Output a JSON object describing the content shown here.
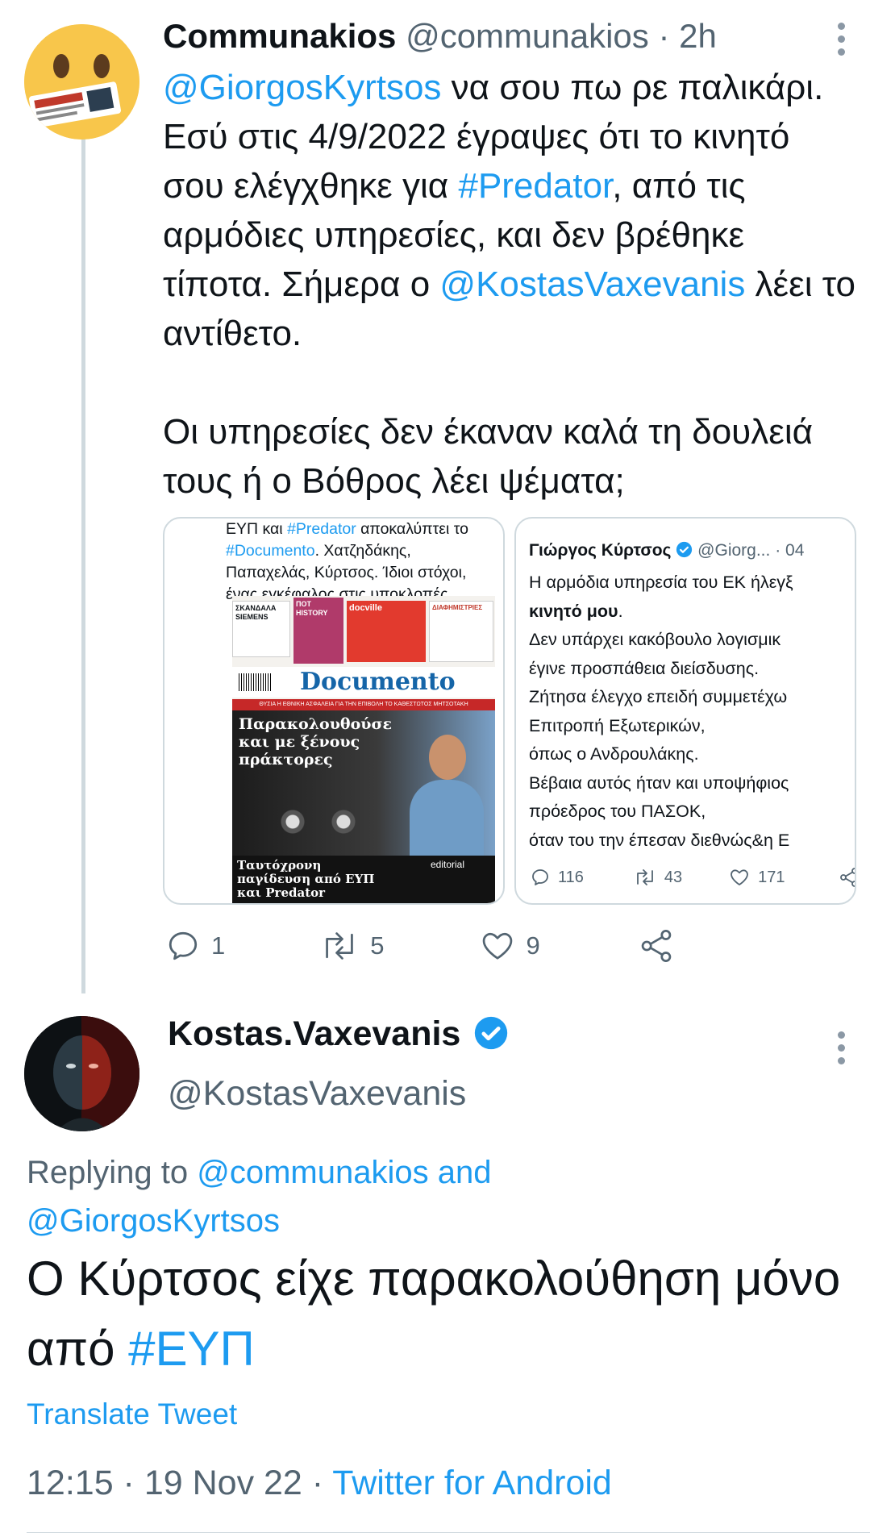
{
  "tweet1": {
    "display_name": "Communakios",
    "handle": "@communakios",
    "separator": "·",
    "time": "2h",
    "body": {
      "mention1": "@GiorgosKyrtsos",
      "seg1": " να σου πω ρε παλικάρι. Εσύ στις 4/9/2022 έγραψες ότι το κινητό σου ελέγχθηκε για ",
      "hashtag": "#Predator",
      "seg2": ", από τις αρμόδιες υπηρεσίες, και δεν βρέθηκε τίποτα. Σήμερα ο ",
      "mention2": "@KostasVaxevanis",
      "seg3": " λέει το αντίθετο.",
      "paragraph2": "Οι υπηρεσίες δεν έκαναν καλά τη δουλειά τους ή ο Βόθρος λέει ψέματα;"
    },
    "quote_left": {
      "text_a": "ΕΥΠ και ",
      "hashtag1": "#Predator",
      "text_b": " αποκαλύπτει το ",
      "hashtag2": "#Documento",
      "text_c": ". Χατζηδάκης, Παπαχελάς, Κύρτσος. Ίδιοι στόχοι, ένας εγκέφαλος στις υποκλοπές.",
      "newspaper": {
        "masthead": "Documento",
        "strip": "ΘΥΣΙΑ Η ΕΘΝΙΚΗ ΑΣΦΑΛΕΙΑ ΓΙΑ ΤΗΝ ΕΠΙΒΟΛΗ ΤΟ ΚΑΘΕΣΤΩΤΟΣ ΜΗΤΣΟΤΑΚΗ",
        "headline": "Παρακολουθούσε και με ξένους πράκτορες",
        "subheadline": "Ταυτόχρονη παγίδευση από ΕΥΠ και Predator",
        "editorial_label": "editorial",
        "insert_1": "ΣΚΑΝΔΑΛΑ SIEMENS",
        "insert_2": "ΠΟΤ ΗISTORY",
        "insert_3": "docville",
        "insert_4": "ΔΙΑΦΗΜΙΣΤΡΙΕΣ"
      }
    },
    "quote_right": {
      "name": "Γιώργος Κύρτσος",
      "handle": "@Giorg...",
      "date": "· 04",
      "line1": "Η αρμόδια υπηρεσία του ΕΚ ήλεγξ",
      "line2": "κινητό μου",
      "line2_end": ".",
      "line3": "Δεν υπάρχει κακόβουλο λογισμικ",
      "line4": "έγινε προσπάθεια διείσδυσης.",
      "line5": "Ζήτησα έλεγχο επειδή συμμετέχω",
      "line6": "Επιτροπή Εξωτερικών,",
      "line7": "όπως ο Ανδρουλάκης.",
      "line8": "Βέβαια αυτός ήταν και υποψήφιος",
      "line9": "πρόεδρος του ΠΑΣΟΚ,",
      "line10": "όταν του την έπεσαν διεθνώς&η Ε",
      "replies": "116",
      "retweets": "43",
      "likes": "171"
    },
    "replies": "1",
    "retweets": "5",
    "likes": "9"
  },
  "tweet2": {
    "display_name": "Kostas.Vaxevanis",
    "handle": "@KostasVaxevanis",
    "replying_prefix": "Replying to ",
    "replying_user1": "@communakios",
    "replying_and": " and",
    "replying_user2": "@GiorgosKyrtsos",
    "body_text": "Ο Κύρτσος είχε παρακολούθηση μόνο από ",
    "body_hashtag": "#ΕΥΠ",
    "translate": "Translate Tweet",
    "time": "12:15",
    "dot1": " · ",
    "date": "19 Nov 22",
    "dot2": " · ",
    "source": "Twitter for Android"
  },
  "colors": {
    "accent": "#1d9bf0",
    "text": "#0f1419",
    "muted": "#536471",
    "border": "#cfd9de",
    "verified": "#1d9bf0"
  }
}
